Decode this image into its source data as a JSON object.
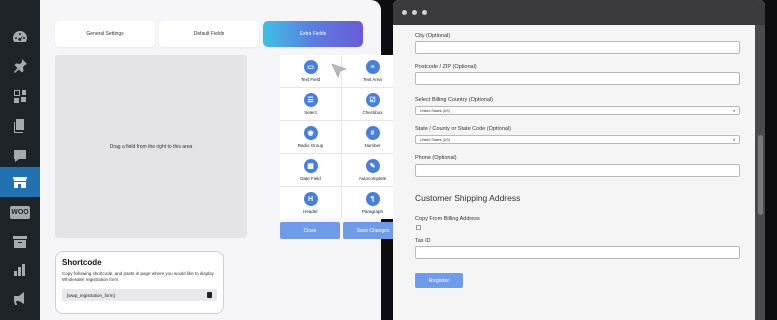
{
  "left_panel": {
    "tabs": [
      "General Settings",
      "Default Fields",
      "Extra Fields"
    ],
    "dropzone_text": "Drag a field from the right to this area",
    "fields": [
      {
        "label": "Text Field",
        "icon": "text-field-icon",
        "glyph": "▭"
      },
      {
        "label": "Text Area",
        "icon": "text-area-icon",
        "glyph": "≡"
      },
      {
        "label": "Select",
        "icon": "select-icon",
        "glyph": "☰"
      },
      {
        "label": "Checkbox",
        "icon": "checkbox-icon",
        "glyph": "☑"
      },
      {
        "label": "Radio Group",
        "icon": "radio-group-icon",
        "glyph": "◉"
      },
      {
        "label": "Number",
        "icon": "number-icon",
        "glyph": "#"
      },
      {
        "label": "Date Field",
        "icon": "date-field-icon",
        "glyph": "▦"
      },
      {
        "label": "Autocomplete",
        "icon": "autocomplete-icon",
        "glyph": "✎"
      },
      {
        "label": "Header",
        "icon": "header-icon",
        "glyph": "H"
      },
      {
        "label": "Paragraph",
        "icon": "paragraph-icon",
        "glyph": "¶"
      }
    ],
    "close_label": "Close",
    "save_label": "Save Changes",
    "shortcode": {
      "title": "Shortcode",
      "description": "Copy following shortcode, and paste in page where you would like to display Wholesaler registration form.",
      "code": "[wwp_registration_form]"
    }
  },
  "form": {
    "city_label": "City (Optional)",
    "postcode_label": "Postcode / ZIP (Optional)",
    "billing_country_label": "Select Billing Country (Optional)",
    "billing_country_value": "United States (US)",
    "state_label": "State / County or State Code (Optional)",
    "state_value": "United States (US)",
    "phone_label": "Phone (Optional)",
    "shipping_title": "Customer Shipping Address",
    "copy_billing_label": "Copy From Billing Address",
    "tax_id_label": "Tax ID",
    "register_label": "Register"
  },
  "colors": {
    "accent": "#6f9be8",
    "wp_sidebar": "#1d2327",
    "wp_active": "#2271b1"
  }
}
